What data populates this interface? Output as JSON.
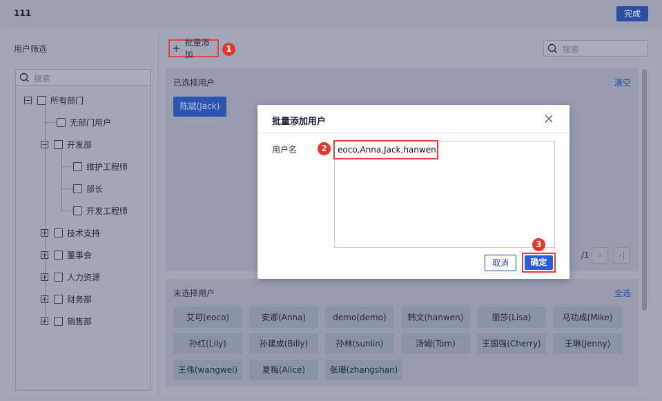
{
  "header": {
    "title": "111",
    "done_label": "完成"
  },
  "left": {
    "title": "用户筛选",
    "search_placeholder": "搜索",
    "tree": [
      {
        "label": "所有部门",
        "expanded": true
      },
      {
        "label": "无部门用户"
      },
      {
        "label": "开发部",
        "expanded": true
      },
      {
        "label": "维护工程师"
      },
      {
        "label": "部长"
      },
      {
        "label": "开发工程师"
      },
      {
        "label": "技术支持",
        "expanded": false
      },
      {
        "label": "董事会",
        "expanded": false
      },
      {
        "label": "人力资源",
        "expanded": false
      },
      {
        "label": "财务部",
        "expanded": false
      },
      {
        "label": "销售部",
        "expanded": false
      }
    ]
  },
  "toolbar": {
    "batch_add_label": "批量添加",
    "search_placeholder": "搜索"
  },
  "selected": {
    "title": "已选择用户",
    "clear_label": "清空",
    "chips": [
      "陈斌(Jack)"
    ],
    "page_text": "/1"
  },
  "unselected": {
    "title": "未选择用户",
    "select_all_label": "全选",
    "chips": [
      "艾可(eoco)",
      "安娜(Anna)",
      "demo(demo)",
      "韩文(hanwen)",
      "丽莎(Lisa)",
      "马功成(Mike)",
      "孙红(Lily)",
      "孙建成(Billy)",
      "孙林(sunlin)",
      "汤姆(Tom)",
      "王国强(Cherry)",
      "王琳(Jenny)",
      "王伟(wangwei)",
      "夏梅(Alice)",
      "张珊(zhangshan)"
    ]
  },
  "modal": {
    "title": "批量添加用户",
    "field_label": "用户名",
    "textarea_value": "eoco,Anna,Jack,hanwen",
    "cancel_label": "取消",
    "ok_label": "确定"
  },
  "badges": {
    "b1": "1",
    "b2": "2",
    "b3": "3"
  },
  "colors": {
    "accent": "#2a5ed6",
    "highlight": "#e5403b"
  }
}
